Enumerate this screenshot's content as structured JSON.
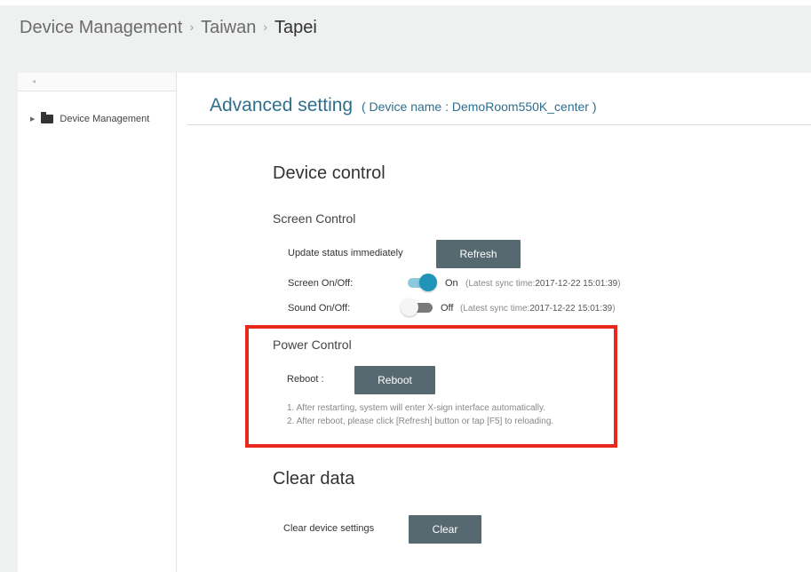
{
  "breadcrumb": {
    "items": [
      "Device Management",
      "Taiwan",
      "Tapei"
    ],
    "separator": "›"
  },
  "sidebar": {
    "tree": [
      {
        "label": "Device Management",
        "icon": "folder-icon",
        "expanded": false
      }
    ]
  },
  "page": {
    "title": "Advanced setting",
    "subtitle": "( Device name : DemoRoom550K_center )"
  },
  "device_control": {
    "heading": "Device control",
    "screen_control": {
      "heading": "Screen Control",
      "update_label": "Update status immediately",
      "refresh_label": "Refresh",
      "screen_label": "Screen On/Off:",
      "screen_state": "On",
      "screen_on": true,
      "sound_label": "Sound On/Off:",
      "sound_state": "Off",
      "sound_on": false,
      "sync_prefix": "(Latest sync time:",
      "screen_sync_time": "2017-12-22 15:01:39",
      "sound_sync_time": "2017-12-22 15:01:39",
      "sync_suffix": ")"
    },
    "power_control": {
      "heading": "Power Control",
      "reboot_label": "Reboot :",
      "reboot_button": "Reboot",
      "notes": [
        "1. After restarting, system will enter X-sign interface automatically.",
        "2. After reboot, please click [Refresh] button or tap [F5] to reloading."
      ]
    }
  },
  "clear_data": {
    "heading": "Clear data",
    "label": "Clear device settings",
    "button": "Clear"
  },
  "colors": {
    "accent_title": "#2e6f8e",
    "button_bg": "#566970",
    "toggle_on": "#1f94b8",
    "highlight_border": "#e8281f"
  }
}
